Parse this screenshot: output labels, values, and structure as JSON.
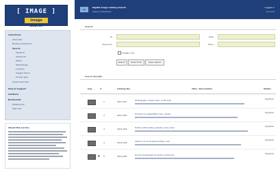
{
  "sidebar": {
    "logo_text": "[ IMAGE ]",
    "logo_tag": "Image Search",
    "nav_items": [
      "Collections",
      "Overview",
      "Browse Collections",
      "Search",
      "Keyword",
      "Advanced",
      "Filters",
      "Date Range",
      "Location",
      "Subject Terms",
      "Format Type",
      "Saved Searches",
      "Help & Support",
      "Citations",
      "Bookmarks",
      "Preferences",
      "Sign Out"
    ],
    "note_title": "About this service"
  },
  "header": {
    "logo_label": "Lib",
    "title": "Digital Image Catalog Search",
    "subtitle": "Library Collections",
    "user_label": "Logged in",
    "user_sub": "Account"
  },
  "search": {
    "section_title": "Search",
    "fields": [
      {
        "label": "ID",
        "value": ""
      },
      {
        "label": "Keywords",
        "value": ""
      },
      {
        "label": "Date",
        "value": ""
      },
      {
        "label": "Place",
        "value": ""
      }
    ],
    "checkbox_text": "Images only",
    "buttons": [
      "Search",
      "Clear form",
      "Save search"
    ]
  },
  "results": {
    "section_title": "Search Results",
    "headers": [
      "Img",
      "#",
      "Catalog No.",
      "Title / Description",
      "Status"
    ],
    "rows": [
      {
        "num": "1",
        "code": "0012-001",
        "title": "Photograph: street view, north side",
        "status": "Digitized"
      },
      {
        "num": "2",
        "code": "0012-002",
        "title": "Portrait of unidentified man, studio",
        "status": "Digitized"
      },
      {
        "num": "3",
        "code": "0012-003",
        "title": "Harbor with sailing vessels, early view",
        "status": "Digitized"
      },
      {
        "num": "4",
        "code": "0012-004",
        "title": "Interior of municipal building, hall",
        "status": "Digitized"
      },
      {
        "num": "5",
        "code": "0012-005",
        "title": "Group photograph at public ceremony",
        "status": "Digitized"
      }
    ]
  }
}
